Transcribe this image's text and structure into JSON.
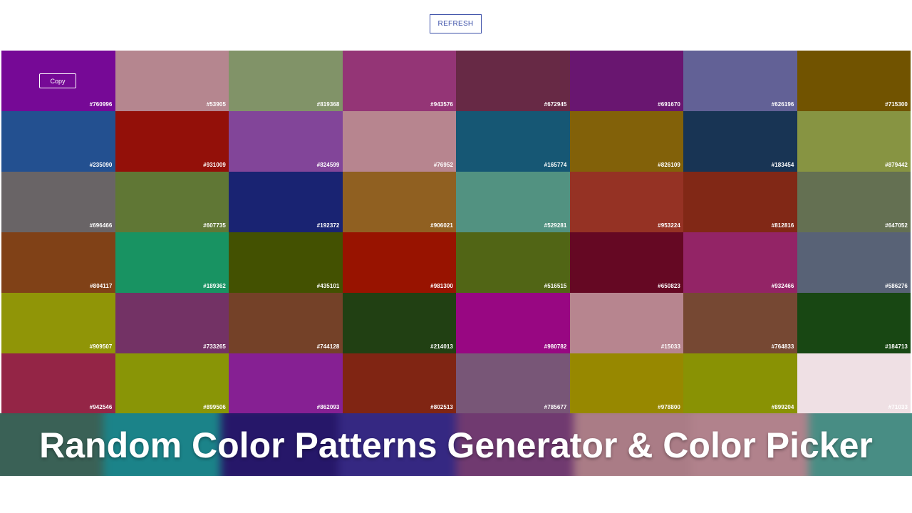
{
  "header": {
    "refresh_label": "REFRESH"
  },
  "copy_label": "Copy",
  "banner": {
    "title": "Random Color Patterns Generator & Color Picker"
  },
  "swatches": [
    {
      "label": "#760996",
      "color": "#760996"
    },
    {
      "label": "#53905",
      "color": "#b5868f"
    },
    {
      "label": "#819368",
      "color": "#819368"
    },
    {
      "label": "#943576",
      "color": "#943576"
    },
    {
      "label": "#672945",
      "color": "#672945"
    },
    {
      "label": "#691670",
      "color": "#691670"
    },
    {
      "label": "#626196",
      "color": "#626196"
    },
    {
      "label": "#715300",
      "color": "#715300"
    },
    {
      "label": "#235090",
      "color": "#235090"
    },
    {
      "label": "#931009",
      "color": "#931009"
    },
    {
      "label": "#824599",
      "color": "#824599"
    },
    {
      "label": "#76952",
      "color": "#b7858f"
    },
    {
      "label": "#165774",
      "color": "#165774"
    },
    {
      "label": "#826109",
      "color": "#826109"
    },
    {
      "label": "#183454",
      "color": "#183454"
    },
    {
      "label": "#879442",
      "color": "#879442"
    },
    {
      "label": "#696466",
      "color": "#696466"
    },
    {
      "label": "#607735",
      "color": "#607735"
    },
    {
      "label": "#192372",
      "color": "#192372"
    },
    {
      "label": "#906021",
      "color": "#906021"
    },
    {
      "label": "#529281",
      "color": "#529281"
    },
    {
      "label": "#953224",
      "color": "#953224"
    },
    {
      "label": "#812816",
      "color": "#812816"
    },
    {
      "label": "#647052",
      "color": "#647052"
    },
    {
      "label": "#804117",
      "color": "#804117"
    },
    {
      "label": "#189362",
      "color": "#189362"
    },
    {
      "label": "#435101",
      "color": "#435101"
    },
    {
      "label": "#981300",
      "color": "#981300"
    },
    {
      "label": "#516515",
      "color": "#516515"
    },
    {
      "label": "#650823",
      "color": "#650823"
    },
    {
      "label": "#932466",
      "color": "#932466"
    },
    {
      "label": "#586276",
      "color": "#586276"
    },
    {
      "label": "#909507",
      "color": "#909507"
    },
    {
      "label": "#733265",
      "color": "#733265"
    },
    {
      "label": "#744128",
      "color": "#744128"
    },
    {
      "label": "#214013",
      "color": "#214013"
    },
    {
      "label": "#980782",
      "color": "#980782"
    },
    {
      "label": "#15033",
      "color": "#b7858f"
    },
    {
      "label": "#764833",
      "color": "#764833"
    },
    {
      "label": "#184713",
      "color": "#184713"
    },
    {
      "label": "#942546",
      "color": "#942546"
    },
    {
      "label": "#899506",
      "color": "#899506"
    },
    {
      "label": "#862093",
      "color": "#862093"
    },
    {
      "label": "#802513",
      "color": "#802513"
    },
    {
      "label": "#785677",
      "color": "#785677"
    },
    {
      "label": "#978800",
      "color": "#978800"
    },
    {
      "label": "#899204",
      "color": "#899204"
    },
    {
      "label": "#71033",
      "color": "#efe0e4"
    },
    {
      "label": "",
      "color": "#5e2248"
    },
    {
      "label": "",
      "color": "#777522"
    },
    {
      "label": "",
      "color": "#979850"
    },
    {
      "label": "",
      "color": "#169152"
    },
    {
      "label": "",
      "color": "#6b3f8a"
    },
    {
      "label": "",
      "color": "#127a2a"
    },
    {
      "label": "",
      "color": "#1f566a"
    },
    {
      "label": "",
      "color": "#973e9a"
    }
  ],
  "band_colors": [
    "#3f6a5e",
    "#1e8f95",
    "#2a1a72",
    "#3a2c8e",
    "#7a3f7a",
    "#b98792",
    "#c08e98",
    "#4f9a90"
  ]
}
